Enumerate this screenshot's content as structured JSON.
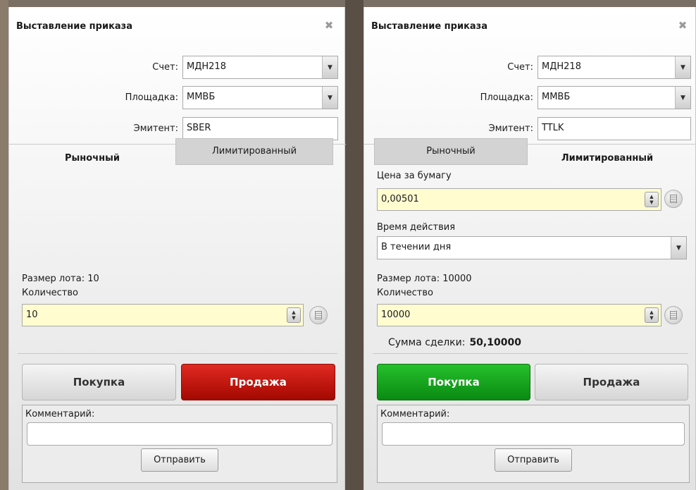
{
  "colors": {
    "panel_bg": "#f4f4f4",
    "input_highlight": "#fffdd0",
    "sell_active": "#c4150d",
    "buy_active": "#16a41d",
    "tab_inactive": "#d3d3d3"
  },
  "left": {
    "title": "Выставление приказа",
    "account_label": "Счет:",
    "account_value": "МДН218",
    "venue_label": "Площадка:",
    "venue_value": "ММВБ",
    "issuer_label": "Эмитент:",
    "issuer_value": "SBER",
    "tab_market": "Рыночный",
    "tab_limit": "Лимитированный",
    "active_tab": "Рыночный",
    "lot_size": "Размер лота: 10",
    "quantity_label": "Количество",
    "quantity_value": "10",
    "buy_label": "Покупка",
    "sell_label": "Продажа",
    "active_side": "Продажа",
    "comment_label": "Комментарий:",
    "comment_value": "",
    "send_label": "Отправить"
  },
  "right": {
    "title": "Выставление приказа",
    "account_label": "Счет:",
    "account_value": "МДН218",
    "venue_label": "Площадка:",
    "venue_value": "ММВБ",
    "issuer_label": "Эмитент:",
    "issuer_value": "TTLK",
    "tab_market": "Рыночный",
    "tab_limit": "Лимитированный",
    "active_tab": "Лимитированный",
    "price_label": "Цена за бумагу",
    "price_value": "0,00501",
    "validity_label": "Время действия",
    "validity_value": "В течении дня",
    "lot_size": "Размер лота: 10000",
    "quantity_label": "Количество",
    "quantity_value": "10000",
    "total_label": "Сумма сделки:",
    "total_value": "50,10000",
    "buy_label": "Покупка",
    "sell_label": "Продажа",
    "active_side": "Покупка",
    "comment_label": "Комментарий:",
    "comment_value": "",
    "send_label": "Отправить"
  },
  "icons": {
    "close": "close-icon",
    "dropdown": "chevron-down-icon",
    "spinner": "spinner-icon",
    "calculator": "calculator-icon"
  }
}
